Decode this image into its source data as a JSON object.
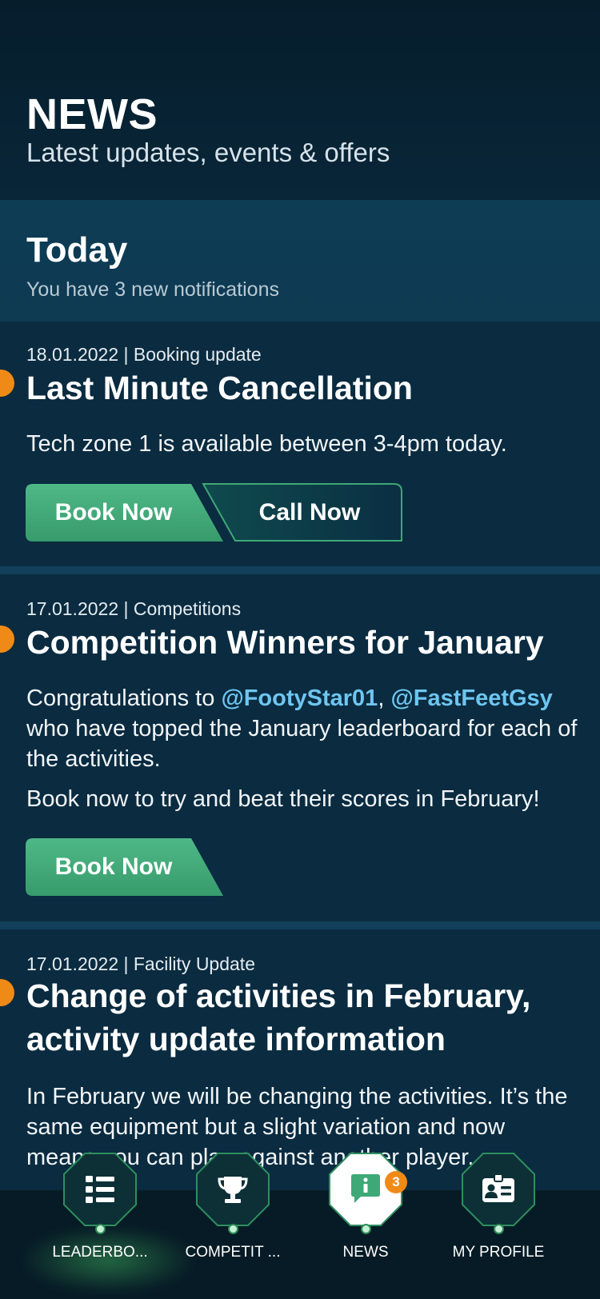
{
  "header": {
    "title": "NEWS",
    "subtitle": "Latest updates, events & offers"
  },
  "today": {
    "title": "Today",
    "subtitle": "You have 3 new notifications"
  },
  "colors": {
    "accent_green": "#3fa877",
    "unread_dot": "#f08a16",
    "mention": "#6ec6f0",
    "background": "#0a2b40"
  },
  "news": [
    {
      "meta": "18.01.2022 | Booking update",
      "title": "Last Minute Cancellation",
      "body": "Tech zone 1 is available between 3-4pm today.",
      "buttons": [
        "Book Now",
        "Call Now"
      ]
    },
    {
      "meta": "17.01.2022 | Competitions",
      "title": "Competition Winners for January",
      "body_pre": "Congratulations to ",
      "mention1": "@FootyStar01",
      "comma": ", ",
      "mention2": "@FastFeetGsy",
      "body_post": " who have topped the January leaderboard for each of the activities.",
      "body2": "Book now to try and beat their scores in February!",
      "buttons": [
        "Book Now"
      ]
    },
    {
      "meta": "17.01.2022 | Facility Update",
      "title": "Change of activities in February, activity update information",
      "body": "In February we will be changing the activities. It’s the same equipment but a slight variation and now means you can play against another player."
    }
  ],
  "nav": {
    "items": [
      {
        "label": "LEADERBO...",
        "icon": "list-icon"
      },
      {
        "label": "COMPETIT ...",
        "icon": "trophy-icon"
      },
      {
        "label": "NEWS",
        "icon": "info-chat-icon",
        "badge": "3"
      },
      {
        "label": "MY PROFILE",
        "icon": "id-card-icon"
      }
    ]
  }
}
